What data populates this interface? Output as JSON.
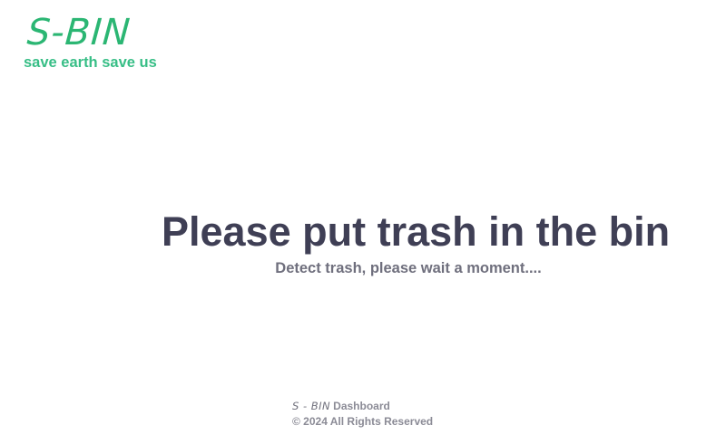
{
  "brand": {
    "logo_text": "S-BIN",
    "tagline": "save earth save us",
    "color": "#2bb673"
  },
  "main": {
    "heading": "Please put trash in the bin",
    "subheading": "Detect trash, please wait a moment...."
  },
  "footer": {
    "logo_text": "S - BIN",
    "dashboard_label": "Dashboard",
    "copyright": "© 2024 All Rights Reserved"
  }
}
